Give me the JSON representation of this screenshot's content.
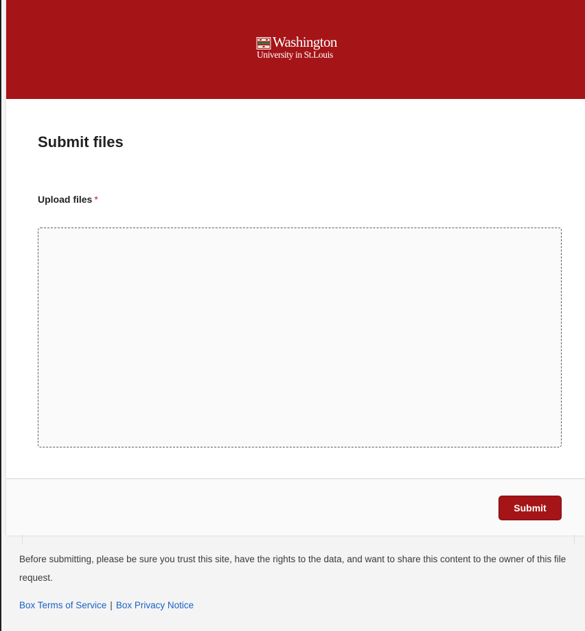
{
  "header": {
    "logo": {
      "line1": "Washington",
      "line2": "University in St.Louis",
      "shield_icon": "university-shield-icon"
    }
  },
  "form": {
    "title": "Submit files",
    "upload_label": "Upload files",
    "required_marker": "*"
  },
  "footer": {
    "submit_label": "Submit",
    "disclaimer": "Before submitting, please be sure you trust this site, have the rights to the data, and want to share this content to the owner of this file request.",
    "terms_link": "Box Terms of Service",
    "separator": "|",
    "privacy_link": "Box Privacy Notice"
  },
  "colors": {
    "brand_red": "#a51417",
    "link_blue": "#1a62c7",
    "required_red": "#c8102e"
  }
}
